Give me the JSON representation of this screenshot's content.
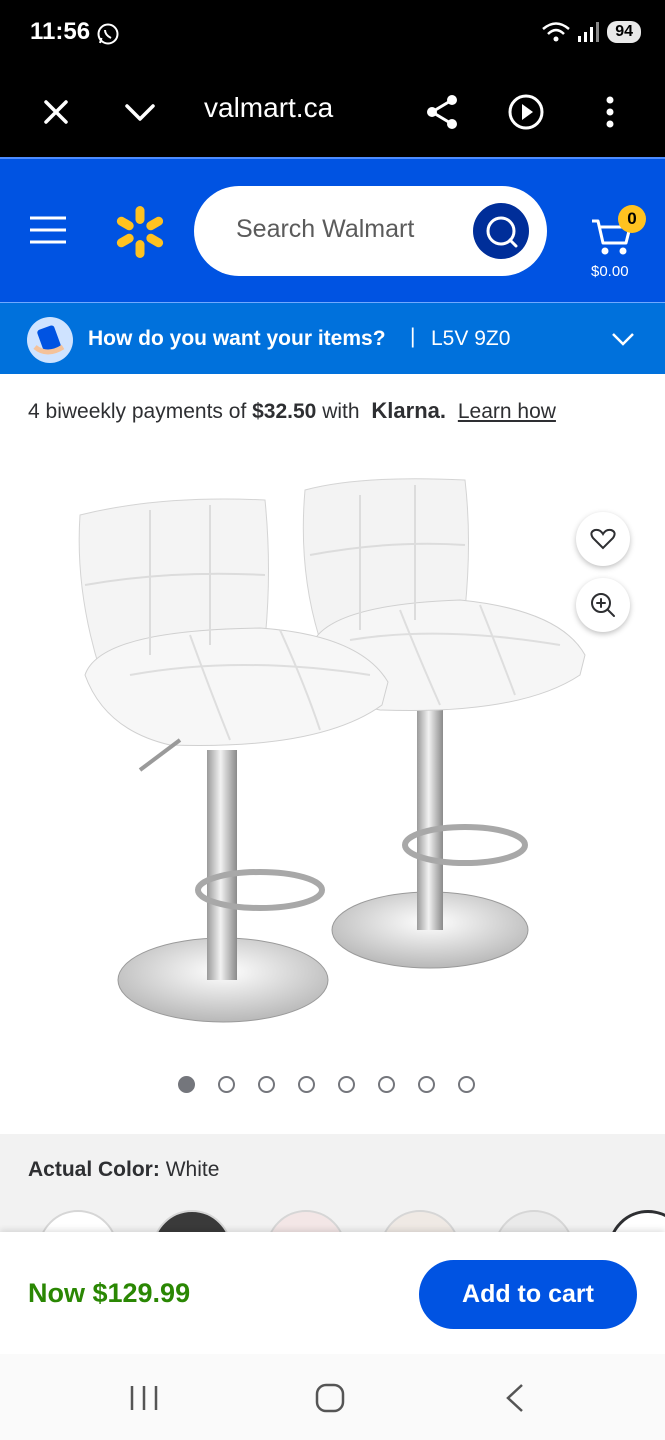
{
  "status_bar": {
    "time": "11:56",
    "battery": "94"
  },
  "browser": {
    "url": "valmart.ca"
  },
  "header": {
    "search_placeholder": "Search Walmart",
    "cart_count": "0",
    "cart_total": "$0.00",
    "accent_color": "#0053e2",
    "spark_color": "#ffc220"
  },
  "delivery": {
    "question": "How do you want your items?",
    "separator": "|",
    "postal_code": "L5V 9Z0"
  },
  "klarna": {
    "prefix": "4 biweekly payments of",
    "amount": "$32.50",
    "mid": "with",
    "brand": "Klarna.",
    "link": "Learn how"
  },
  "carousel": {
    "total_images": 8,
    "active_index": 0
  },
  "color_section": {
    "label": "Actual Color:",
    "value": "White"
  },
  "buy_bar": {
    "price": "Now $129.99",
    "add_to_cart": "Add to cart",
    "price_color": "#2a8703"
  }
}
